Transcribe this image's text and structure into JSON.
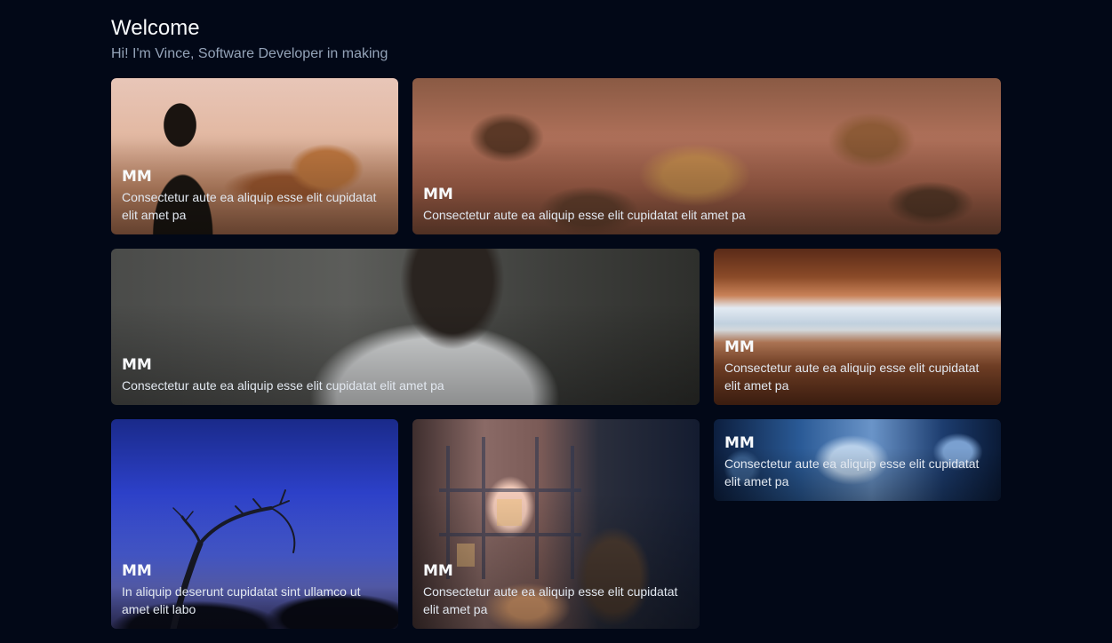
{
  "header": {
    "title": "Welcome",
    "subtitle": "Hi! I'm Vince, Software Developer in making"
  },
  "colors": {
    "background": "#020817",
    "title": "#f8fafc",
    "subtitle": "#94a3b8"
  },
  "cards": [
    {
      "name": "MM",
      "description": "Consectetur aute ea aliquip esse elit cupidatat elit amet pa"
    },
    {
      "name": "MM",
      "description": "Consectetur aute ea aliquip esse elit cupidatat elit amet pa"
    },
    {
      "name": "MM",
      "description": "Consectetur aute ea aliquip esse elit cupidatat elit amet pa"
    },
    {
      "name": "MM",
      "description": "Consectetur aute ea aliquip esse elit cupidatat elit amet pa"
    },
    {
      "name": "MM",
      "description": "In aliquip deserunt cupidatat sint ullamco ut amet elit labo"
    },
    {
      "name": "MM",
      "description": "Consectetur aute ea aliquip esse elit cupidatat elit amet pa"
    },
    {
      "name": "MM",
      "description": "Consectetur aute ea aliquip esse elit cupidatat elit amet pa"
    }
  ]
}
